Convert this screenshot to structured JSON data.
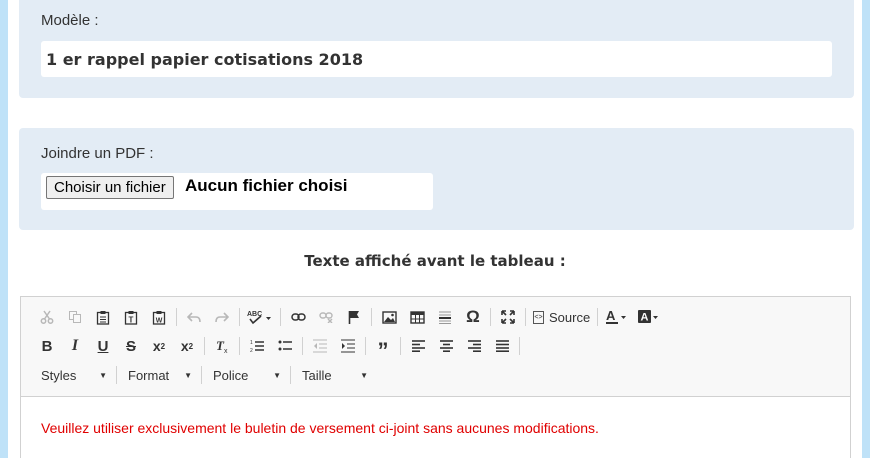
{
  "model": {
    "label": "Modèle :",
    "value": "1 er rappel papier cotisations 2018"
  },
  "pdf": {
    "label": "Joindre un PDF :",
    "button": "Choisir un fichier",
    "status": "Aucun fichier choisi"
  },
  "section": {
    "title": "Texte affiché avant le tableau :"
  },
  "editor": {
    "toolbar": {
      "source_label": "Source",
      "combos": {
        "styles": "Styles",
        "format": "Format",
        "font": "Police",
        "size": "Taille"
      }
    },
    "content": "Veuillez utiliser exclusivement le buletin de versement ci-joint sans aucunes modifications."
  },
  "colors": {
    "panel": "#e3ecf5",
    "side_bar": "#bfe2f8",
    "content_text": "#e00000"
  }
}
